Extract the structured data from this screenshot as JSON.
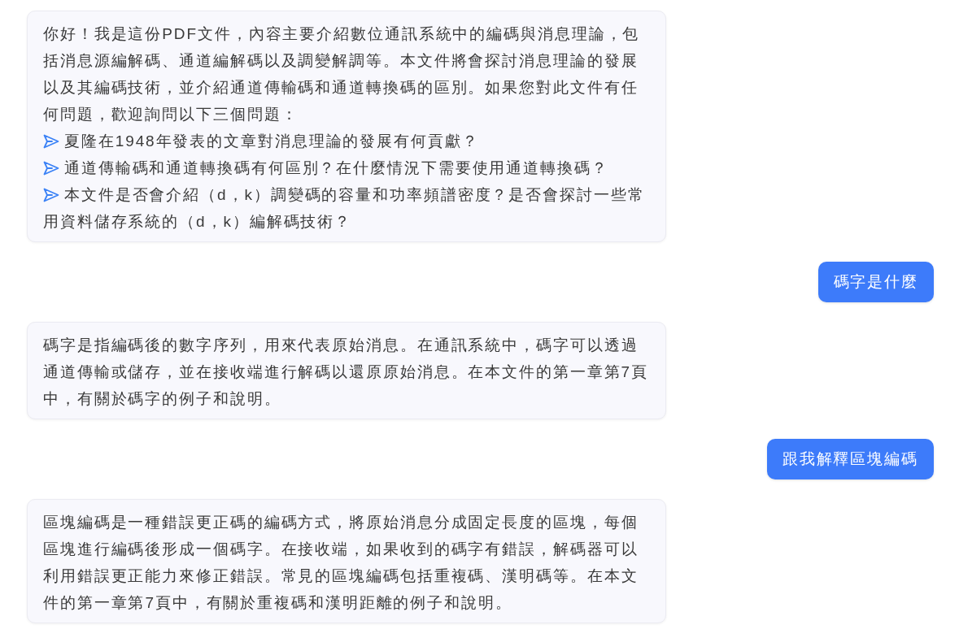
{
  "messages": [
    {
      "kind": "bot",
      "text": "你好！我是這份PDF文件，內容主要介紹數位通訊系統中的編碼與消息理論，包括消息源編解碼、通道編解碼以及調變解調等。本文件將會探討消息理論的發展以及其編碼技術，並介紹通道傳輸碼和通道轉換碼的區別。如果您對此文件有任何問題，歡迎詢問以下三個問題：",
      "questions": [
        "夏隆在1948年發表的文章對消息理論的發展有何貢獻？",
        "通道傳輸碼和通道轉換碼有何區別？在什麼情況下需要使用通道轉換碼？",
        "本文件是否會介紹（d，k）調變碼的容量和功率頻譜密度？是否會探討一些常用資料儲存系統的（d，k）編解碼技術？"
      ]
    },
    {
      "kind": "user",
      "text": "碼字是什麼"
    },
    {
      "kind": "bot",
      "text": "碼字是指編碼後的數字序列，用來代表原始消息。在通訊系統中，碼字可以透過通道傳輸或儲存，並在接收端進行解碼以還原原始消息。在本文件的第一章第7頁中，有關於碼字的例子和說明。"
    },
    {
      "kind": "user",
      "text": "跟我解釋區塊編碼"
    },
    {
      "kind": "bot",
      "text": "區塊編碼是一種錯誤更正碼的編碼方式，將原始消息分成固定長度的區塊，每個區塊進行編碼後形成一個碼字。在接收端，如果收到的碼字有錯誤，解碼器可以利用錯誤更正能力來修正錯誤。常見的區塊編碼包括重複碼、漢明碼等。在本文件的第一章第7頁中，有關於重複碼和漢明距離的例子和說明。"
    }
  ]
}
